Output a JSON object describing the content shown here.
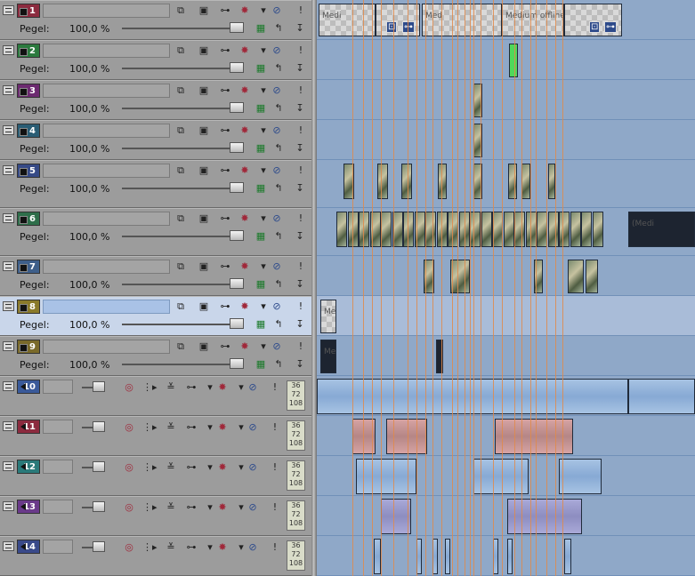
{
  "colors": {
    "accent": "#2d4a8a",
    "marker": "#e08a4a",
    "timeline_bg": "#8fa8c8"
  },
  "icons": {
    "minimize": "minimize-track-icon",
    "composite": "composite-mode-icon",
    "parent": "parent-track-icon",
    "pan": "track-motion-icon",
    "fx": "track-fx-icon",
    "mute": "mute-icon",
    "solo": "solo-icon",
    "reset": "reset-level-icon",
    "automation": "automation-icon",
    "arrow": "arrow-down-icon"
  },
  "video_tracks": [
    {
      "number": "1",
      "color": "#8c2b3f",
      "level_label": "Pegel:",
      "level_value": "100,0 %",
      "level": 1.0
    },
    {
      "number": "2",
      "color": "#2b7a3e",
      "level_label": "Pegel:",
      "level_value": "100,0 %",
      "level": 1.0
    },
    {
      "number": "3",
      "color": "#6c2a70",
      "level_label": "Pegel:",
      "level_value": "100,0 %",
      "level": 1.0
    },
    {
      "number": "4",
      "color": "#2a5d74",
      "level_label": "Pegel:",
      "level_value": "100,0 %",
      "level": 1.0
    },
    {
      "number": "5",
      "color": "#364a86",
      "level_label": "Pegel:",
      "level_value": "100,0 %",
      "level": 1.0
    },
    {
      "number": "6",
      "color": "#2e6e4a",
      "level_label": "Pegel:",
      "level_value": "100,0 %",
      "level": 1.0
    },
    {
      "number": "7",
      "color": "#3e5f8a",
      "level_label": "Pegel:",
      "level_value": "100,0 %",
      "level": 1.0
    },
    {
      "number": "8",
      "color": "#8a7a2a",
      "level_label": "Pegel:",
      "level_value": "100,0 %",
      "level": 1.0
    },
    {
      "number": "9",
      "color": "#7a6a2a",
      "level_label": "Pegel:",
      "level_value": "100,0 %",
      "level": 1.0
    }
  ],
  "audio_tracks": [
    {
      "number": "10",
      "color": "#3a5a9a",
      "meter": [
        "36",
        "72",
        "108"
      ]
    },
    {
      "number": "11",
      "color": "#8c2b3f",
      "meter": [
        "36",
        "72",
        "108"
      ]
    },
    {
      "number": "12",
      "color": "#2a7a7a",
      "meter": [
        "36",
        "72",
        "108"
      ]
    },
    {
      "number": "13",
      "color": "#6a3a8a",
      "meter": [
        "36",
        "72",
        "108"
      ]
    },
    {
      "number": "14",
      "color": "#3a4a8a",
      "meter": [
        "36",
        "72",
        "108"
      ]
    }
  ],
  "clips": {
    "track1_labels": [
      "Medi",
      "Med",
      "Medium offline"
    ],
    "track8_label": "Me",
    "track9_label": "Med",
    "track6_end_label": "(Medi",
    "track6_end_label2": "offlin"
  }
}
